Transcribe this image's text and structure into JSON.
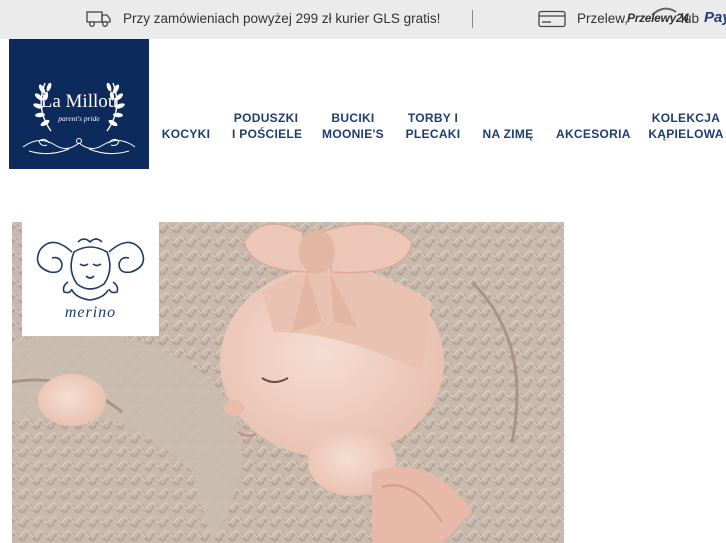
{
  "topbar": {
    "shipping_icon": "truck-icon",
    "shipping_text": "Przy zamówieniach powyżej 299 zł kurier GLS gratis!",
    "payment_icon": "credit-card-icon",
    "payment_text": "Przelew,",
    "przelewy24_logo_text": "Przelewy24",
    "or_text": "lub",
    "paypal_text": "Pay"
  },
  "logo": {
    "brand": "La Millou",
    "tagline": "parent's pride",
    "background": "#0d2a5c"
  },
  "nav": {
    "color": "#1e3d73",
    "items": [
      {
        "line1": "KOCYKI",
        "line2": ""
      },
      {
        "line1": "PODUSZKI",
        "line2": "I POŚCIELE"
      },
      {
        "line1": "BUCIKI",
        "line2": "MOONIE'S"
      },
      {
        "line1": "TORBY I",
        "line2": "PLECAKI"
      },
      {
        "line1": "NA ZIMĘ",
        "line2": ""
      },
      {
        "line1": "AKCESORIA",
        "line2": ""
      },
      {
        "line1": "KOLEKCJA",
        "line2": "KĄPIELOWA"
      }
    ]
  },
  "hero": {
    "badge_label": "merino"
  }
}
